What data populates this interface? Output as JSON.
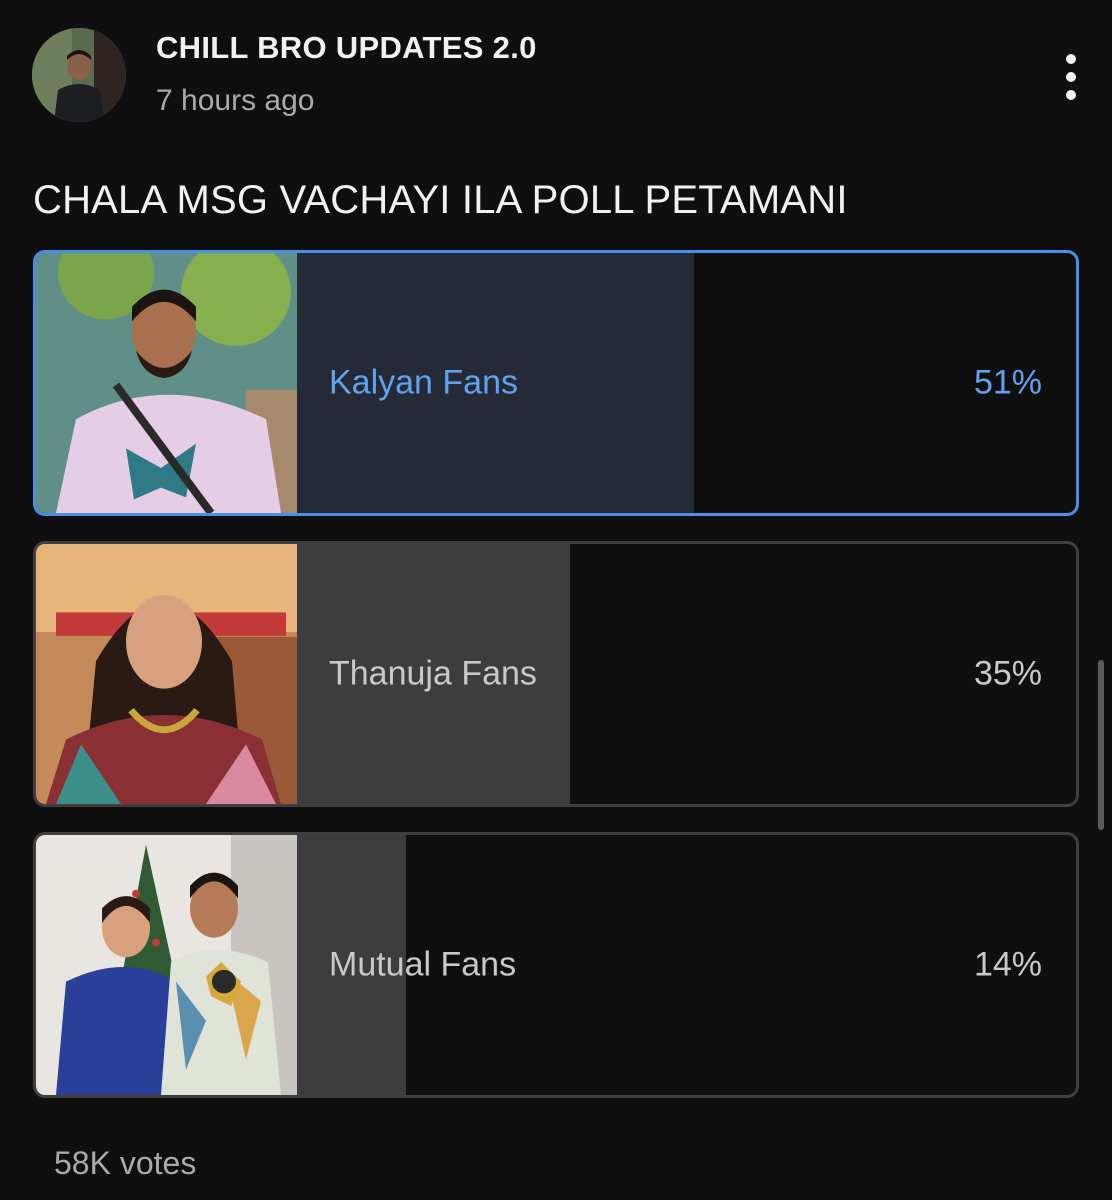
{
  "channel": {
    "name": "CHILL BRO UPDATES 2.0",
    "time": "7 hours ago"
  },
  "poll": {
    "question": "CHALA MSG VACHAYI ILA POLL PETAMANI",
    "options": [
      {
        "label": "Kalyan Fans",
        "percent_text": "51%",
        "percent": 51,
        "selected": true
      },
      {
        "label": "Thanuja Fans",
        "percent_text": "35%",
        "percent": 35,
        "selected": false
      },
      {
        "label": "Mutual Fans",
        "percent_text": "14%",
        "percent": 14,
        "selected": false
      }
    ],
    "votes": "58K votes"
  },
  "icons": {
    "more": "more-vertical-icon"
  },
  "colors": {
    "background": "#0f0f0f",
    "accent": "#5fa2f0",
    "selected_border": "#4a8fe7",
    "bar_selected": "#262936",
    "bar_default": "#3d3d3d"
  }
}
